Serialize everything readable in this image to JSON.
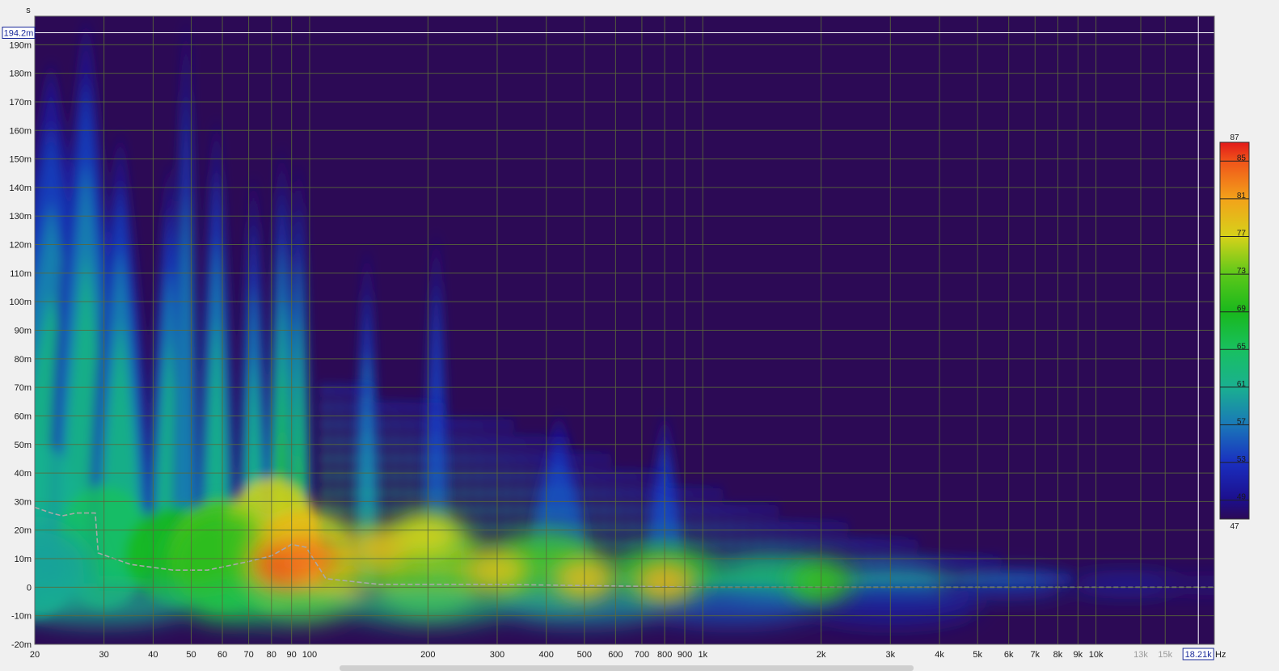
{
  "window": {
    "accent": "#2c0a55",
    "plot_border": "#6a6a6a",
    "grid": "#5a6a3a"
  },
  "units": {
    "y": "s",
    "x": "Hz"
  },
  "cursors": {
    "time": "194.2m",
    "frequency": "18.21k"
  },
  "chart_data": {
    "type": "heatmap",
    "title": "",
    "xlabel": "Hz",
    "ylabel": "s",
    "xscale": "log",
    "xlim": [
      20,
      20000
    ],
    "ylim": [
      -20,
      200
    ],
    "grid": true,
    "x_ticks": [
      {
        "v": 20,
        "label": "20"
      },
      {
        "v": 30,
        "label": "30"
      },
      {
        "v": 40,
        "label": "40"
      },
      {
        "v": 50,
        "label": "50"
      },
      {
        "v": 60,
        "label": "60"
      },
      {
        "v": 70,
        "label": "70"
      },
      {
        "v": 80,
        "label": "80"
      },
      {
        "v": 90,
        "label": "90"
      },
      {
        "v": 100,
        "label": "100"
      },
      {
        "v": 200,
        "label": "200"
      },
      {
        "v": 300,
        "label": "300"
      },
      {
        "v": 400,
        "label": "400"
      },
      {
        "v": 500,
        "label": "500"
      },
      {
        "v": 600,
        "label": "600"
      },
      {
        "v": 700,
        "label": "700"
      },
      {
        "v": 800,
        "label": "800"
      },
      {
        "v": 900,
        "label": "900"
      },
      {
        "v": 1000,
        "label": "1k"
      },
      {
        "v": 2000,
        "label": "2k"
      },
      {
        "v": 3000,
        "label": "3k"
      },
      {
        "v": 4000,
        "label": "4k"
      },
      {
        "v": 5000,
        "label": "5k"
      },
      {
        "v": 6000,
        "label": "6k"
      },
      {
        "v": 7000,
        "label": "7k"
      },
      {
        "v": 8000,
        "label": "8k"
      },
      {
        "v": 9000,
        "label": "9k"
      },
      {
        "v": 10000,
        "label": "10k"
      },
      {
        "v": 13000,
        "label": "13k",
        "dim": true
      },
      {
        "v": 15000,
        "label": "15k",
        "dim": true
      }
    ],
    "y_ticks": [
      {
        "v": 190,
        "label": "190m"
      },
      {
        "v": 180,
        "label": "180m"
      },
      {
        "v": 170,
        "label": "170m"
      },
      {
        "v": 160,
        "label": "160m"
      },
      {
        "v": 150,
        "label": "150m"
      },
      {
        "v": 140,
        "label": "140m"
      },
      {
        "v": 130,
        "label": "130m"
      },
      {
        "v": 120,
        "label": "120m"
      },
      {
        "v": 110,
        "label": "110m"
      },
      {
        "v": 100,
        "label": "100m"
      },
      {
        "v": 90,
        "label": "90m"
      },
      {
        "v": 80,
        "label": "80m"
      },
      {
        "v": 70,
        "label": "70m"
      },
      {
        "v": 60,
        "label": "60m"
      },
      {
        "v": 50,
        "label": "50m"
      },
      {
        "v": 40,
        "label": "40m"
      },
      {
        "v": 30,
        "label": "30m"
      },
      {
        "v": 20,
        "label": "20m"
      },
      {
        "v": 10,
        "label": "10m"
      },
      {
        "v": 0,
        "label": "0"
      },
      {
        "v": -10,
        "label": "-10m"
      },
      {
        "v": -20,
        "label": "-20m"
      }
    ],
    "colorbar": {
      "min": 47,
      "max": 87,
      "ticks": [
        87,
        85,
        81,
        77,
        73,
        69,
        65,
        61,
        57,
        53,
        49,
        47
      ],
      "stops": [
        {
          "v": 47,
          "color": "#2c0a55"
        },
        {
          "v": 49,
          "color": "#1c0e8c"
        },
        {
          "v": 53,
          "color": "#1a2fc0"
        },
        {
          "v": 57,
          "color": "#1a78b8"
        },
        {
          "v": 61,
          "color": "#1ab090"
        },
        {
          "v": 65,
          "color": "#18c060"
        },
        {
          "v": 69,
          "color": "#19b81c"
        },
        {
          "v": 73,
          "color": "#5cc81a"
        },
        {
          "v": 77,
          "color": "#d6d21a"
        },
        {
          "v": 81,
          "color": "#f3a21a"
        },
        {
          "v": 85,
          "color": "#f0541a"
        },
        {
          "v": 87,
          "color": "#e21a1a"
        }
      ]
    },
    "decay_curve_dashed": [
      {
        "x": 20,
        "y": 28
      },
      {
        "x": 22,
        "y": 26
      },
      {
        "x": 23.5,
        "y": 25
      },
      {
        "x": 25.5,
        "y": 26
      },
      {
        "x": 28.5,
        "y": 26
      },
      {
        "x": 29,
        "y": 12
      },
      {
        "x": 35,
        "y": 8
      },
      {
        "x": 45,
        "y": 6
      },
      {
        "x": 55,
        "y": 6
      },
      {
        "x": 70,
        "y": 9
      },
      {
        "x": 80,
        "y": 11
      },
      {
        "x": 90,
        "y": 15
      },
      {
        "x": 98,
        "y": 14
      },
      {
        "x": 110,
        "y": 3
      },
      {
        "x": 150,
        "y": 1
      },
      {
        "x": 300,
        "y": 1
      },
      {
        "x": 1000,
        "y": 0
      },
      {
        "x": 20000,
        "y": 0
      }
    ],
    "ridges": [
      {
        "f": 22,
        "level": 61,
        "top": 185,
        "w": 0.09
      },
      {
        "f": 27,
        "level": 63,
        "top": 200,
        "w": 0.06
      },
      {
        "f": 33,
        "level": 63,
        "top": 160,
        "w": 0.05
      },
      {
        "f": 44,
        "level": 63,
        "top": 150,
        "w": 0.035
      },
      {
        "f": 48.5,
        "level": 57,
        "top": 200,
        "w": 0.02
      },
      {
        "f": 58,
        "level": 62,
        "top": 165,
        "w": 0.03
      },
      {
        "f": 72,
        "level": 61,
        "top": 145,
        "w": 0.025
      },
      {
        "f": 85,
        "level": 73,
        "top": 155,
        "w": 0.025
      },
      {
        "f": 94,
        "level": 69,
        "top": 150,
        "w": 0.02
      },
      {
        "f": 140,
        "level": 57,
        "top": 120,
        "w": 0.02
      },
      {
        "f": 210,
        "level": 55,
        "top": 125,
        "w": 0.02
      },
      {
        "f": 430,
        "level": 53,
        "top": 62,
        "w": 0.05
      },
      {
        "f": 800,
        "level": 53,
        "top": 62,
        "w": 0.03
      }
    ],
    "hotspots": [
      {
        "f": 88,
        "t": 8,
        "level": 86
      },
      {
        "f": 100,
        "t": 10,
        "level": 83
      },
      {
        "f": 150,
        "t": 14,
        "level": 79
      },
      {
        "f": 200,
        "t": 18,
        "level": 77
      },
      {
        "f": 300,
        "t": 6,
        "level": 78
      },
      {
        "f": 500,
        "t": 3,
        "level": 79
      },
      {
        "f": 800,
        "t": 2,
        "level": 80
      },
      {
        "f": 2000,
        "t": 2,
        "level": 71
      }
    ]
  }
}
